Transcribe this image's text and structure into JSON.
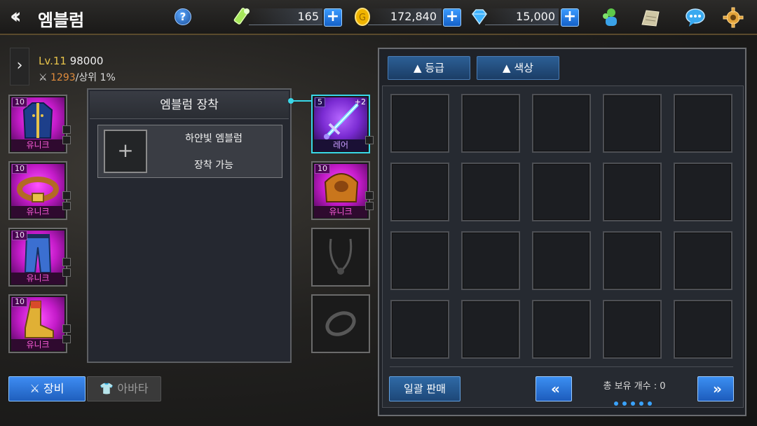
{
  "header": {
    "title": "엠블럼",
    "help": "?",
    "stamina": "165",
    "gold": "172,840",
    "gems": "15,000",
    "plus": "+"
  },
  "player": {
    "level": "Lv.11",
    "exp": "98000",
    "power": "1293",
    "rank": "/상위 1%"
  },
  "left_slots": [
    {
      "level": "10",
      "grade": "유니크",
      "item": "jacket"
    },
    {
      "level": "10",
      "grade": "유니크",
      "item": "belt"
    },
    {
      "level": "10",
      "grade": "유니크",
      "item": "pants"
    },
    {
      "level": "10",
      "grade": "유니크",
      "item": "boots"
    }
  ],
  "equip_panel": {
    "header": "엠블럼 장착",
    "add": "+",
    "emblem_name": "하얀빛 엠블럼",
    "emblem_status": "장착 가능"
  },
  "right_slots": {
    "weapon": {
      "level": "5",
      "plus": "+2",
      "grade": "레어"
    },
    "armor": {
      "level": "10",
      "grade": "유니크"
    }
  },
  "tabs": {
    "equip": "장비",
    "avatar": "아바타"
  },
  "inventory": {
    "sort_grade": "▲ 등급",
    "sort_color": "▲ 색상",
    "sell_all": "일괄 판매",
    "prev": "«",
    "next": "»",
    "count_label": "총 보유 개수 : 0",
    "pages": 5
  },
  "colors": {
    "unique": "#ff5ddd",
    "rare": "#c99cff",
    "accent": "#39d7e8",
    "button_blue": "#2f6aa6"
  }
}
